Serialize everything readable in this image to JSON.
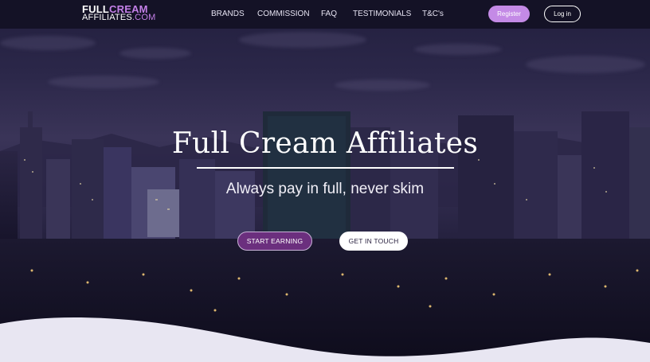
{
  "brand": {
    "line1_a": "FULL",
    "line1_b": "CREAM",
    "line2_a": "AFFILIATES",
    "line2_b": ".COM"
  },
  "nav": {
    "items": [
      {
        "label": "BRANDS"
      },
      {
        "label": "COMMISSION"
      },
      {
        "label": "FAQ"
      },
      {
        "label": "TESTIMONIALS"
      },
      {
        "label": "T&C's"
      }
    ],
    "register_label": "Register",
    "login_label": "Log in"
  },
  "hero": {
    "title": "Full Cream Affiliates",
    "tagline": "Always pay in full, never skim",
    "primary_cta": "START EARNING",
    "secondary_cta": "GET IN TOUCH"
  },
  "colors": {
    "accent": "#c480e8",
    "register_bg": "#c48ae6",
    "start_bg": "#6b2f7e",
    "topbar_bg": "#141226",
    "wave": "#e8e6f2"
  }
}
